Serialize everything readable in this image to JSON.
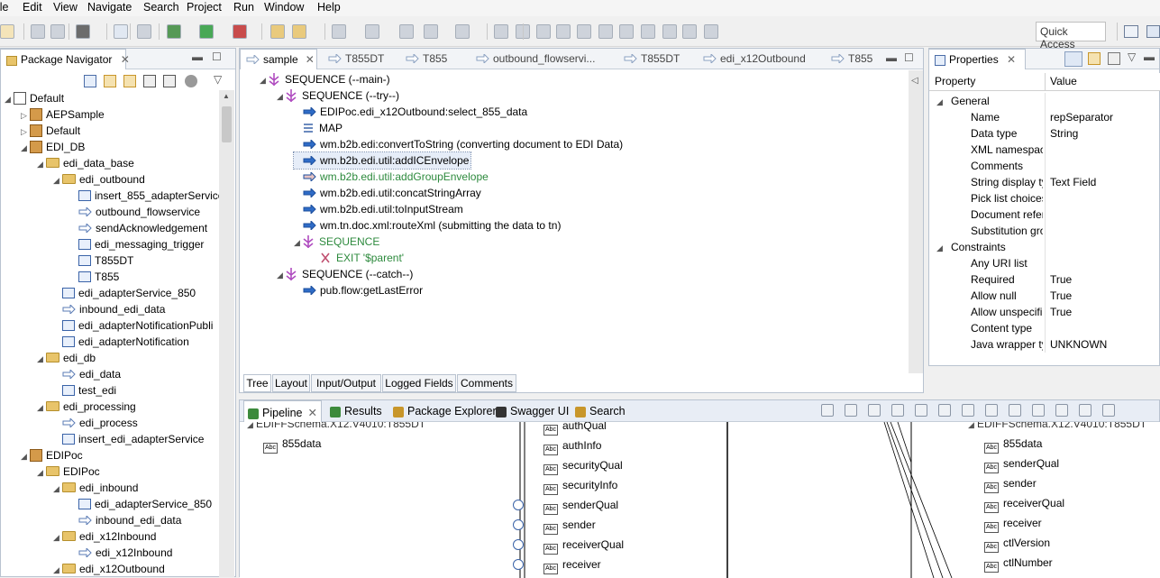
{
  "menu": [
    "ile",
    "Edit",
    "View",
    "Navigate",
    "Search",
    "Project",
    "Run",
    "Window",
    "Help"
  ],
  "toolbar": {
    "quick_access": "Quick Access"
  },
  "navigator": {
    "title": "Package Navigator",
    "items": [
      {
        "label": "Default",
        "depth": 0,
        "kind": "root",
        "exp": "open"
      },
      {
        "label": "AEPSample",
        "depth": 1,
        "kind": "pkg",
        "exp": "closed"
      },
      {
        "label": "Default",
        "depth": 1,
        "kind": "pkg",
        "exp": "closed"
      },
      {
        "label": "EDI_DB",
        "depth": 1,
        "kind": "pkg",
        "exp": "open"
      },
      {
        "label": "edi_data_base",
        "depth": 2,
        "kind": "folder",
        "exp": "open"
      },
      {
        "label": "edi_outbound",
        "depth": 3,
        "kind": "folder",
        "exp": "open"
      },
      {
        "label": "insert_855_adapterService",
        "depth": 4,
        "kind": "adapter",
        "exp": ""
      },
      {
        "label": "outbound_flowservice",
        "depth": 4,
        "kind": "flow",
        "exp": ""
      },
      {
        "label": "sendAcknowledgement",
        "depth": 4,
        "kind": "flow",
        "exp": ""
      },
      {
        "label": "edi_messaging_trigger",
        "depth": 4,
        "kind": "trigger",
        "exp": ""
      },
      {
        "label": "T855DT",
        "depth": 4,
        "kind": "doc",
        "exp": ""
      },
      {
        "label": "T855",
        "depth": 4,
        "kind": "schema",
        "exp": ""
      },
      {
        "label": "edi_adapterService_850",
        "depth": 3,
        "kind": "adapter",
        "exp": ""
      },
      {
        "label": "inbound_edi_data",
        "depth": 3,
        "kind": "flow",
        "exp": ""
      },
      {
        "label": "edi_adapterNotificationPubli",
        "depth": 3,
        "kind": "doc",
        "exp": ""
      },
      {
        "label": "edi_adapterNotification",
        "depth": 3,
        "kind": "adapter",
        "exp": ""
      },
      {
        "label": "edi_db",
        "depth": 2,
        "kind": "folder",
        "exp": "open"
      },
      {
        "label": "edi_data",
        "depth": 3,
        "kind": "flow",
        "exp": ""
      },
      {
        "label": "test_edi",
        "depth": 3,
        "kind": "java",
        "exp": ""
      },
      {
        "label": "edi_processing",
        "depth": 2,
        "kind": "folder",
        "exp": "open"
      },
      {
        "label": "edi_process",
        "depth": 3,
        "kind": "flow",
        "exp": ""
      },
      {
        "label": "insert_edi_adapterService",
        "depth": 3,
        "kind": "adapter",
        "exp": ""
      },
      {
        "label": "EDIPoc",
        "depth": 1,
        "kind": "pkg",
        "exp": "open"
      },
      {
        "label": "EDIPoc",
        "depth": 2,
        "kind": "folder",
        "exp": "open"
      },
      {
        "label": "edi_inbound",
        "depth": 3,
        "kind": "folder",
        "exp": "open"
      },
      {
        "label": "edi_adapterService_850",
        "depth": 4,
        "kind": "adapter",
        "exp": ""
      },
      {
        "label": "inbound_edi_data",
        "depth": 4,
        "kind": "flow",
        "exp": ""
      },
      {
        "label": "edi_x12Inbound",
        "depth": 3,
        "kind": "folder",
        "exp": "open"
      },
      {
        "label": "edi_x12Inbound",
        "depth": 4,
        "kind": "flow",
        "exp": ""
      },
      {
        "label": "edi_x12Outbound",
        "depth": 3,
        "kind": "folder",
        "exp": "open"
      }
    ]
  },
  "editor": {
    "tabs": [
      "sample",
      "T855DT",
      "T855",
      "outbound_flowservi...",
      "T855DT",
      "edi_x12Outbound",
      "T855"
    ],
    "steps": [
      {
        "label": "SEQUENCE (--main-)",
        "depth": 0,
        "kind": "seq",
        "exp": "open",
        "style": ""
      },
      {
        "label": "SEQUENCE (--try--)",
        "depth": 1,
        "kind": "seq",
        "exp": "open",
        "style": ""
      },
      {
        "label": "EDIPoc.edi_x12Outbound:select_855_data",
        "depth": 2,
        "kind": "invoke",
        "exp": "",
        "style": ""
      },
      {
        "label": "MAP",
        "depth": 2,
        "kind": "map",
        "exp": "",
        "style": ""
      },
      {
        "label": "wm.b2b.edi:convertToString (converting document to EDI Data)",
        "depth": 2,
        "kind": "invoke",
        "exp": "",
        "style": ""
      },
      {
        "label": "wm.b2b.edi.util:addICEnvelope",
        "depth": 2,
        "kind": "invoke",
        "exp": "",
        "style": "selected"
      },
      {
        "label": "wm.b2b.edi.util:addGroupEnvelope",
        "depth": 2,
        "kind": "disabled",
        "exp": "",
        "style": "green"
      },
      {
        "label": "wm.b2b.edi.util:concatStringArray",
        "depth": 2,
        "kind": "invoke",
        "exp": "",
        "style": ""
      },
      {
        "label": "wm.b2b.edi.util:toInputStream",
        "depth": 2,
        "kind": "invoke",
        "exp": "",
        "style": ""
      },
      {
        "label": "wm.tn.doc.xml:routeXml (submitting the data to tn)",
        "depth": 2,
        "kind": "invoke",
        "exp": "",
        "style": ""
      },
      {
        "label": "SEQUENCE",
        "depth": 2,
        "kind": "seqdisabled",
        "exp": "open",
        "style": "green"
      },
      {
        "label": "EXIT '$parent'",
        "depth": 3,
        "kind": "exit",
        "exp": "",
        "style": "green"
      },
      {
        "label": "SEQUENCE (--catch--)",
        "depth": 1,
        "kind": "seq",
        "exp": "open",
        "style": ""
      },
      {
        "label": "pub.flow:getLastError",
        "depth": 2,
        "kind": "invoke",
        "exp": "",
        "style": ""
      }
    ],
    "bottom_tabs": [
      "Tree",
      "Layout",
      "Input/Output",
      "Logged Fields",
      "Comments"
    ]
  },
  "properties": {
    "title": "Properties",
    "col_property": "Property",
    "col_value": "Value",
    "rows": [
      {
        "name": "General",
        "value": "",
        "group": true
      },
      {
        "name": "Name",
        "value": "repSeparator",
        "group": false
      },
      {
        "name": "Data type",
        "value": "String",
        "group": false
      },
      {
        "name": "XML namespac",
        "value": "",
        "group": false
      },
      {
        "name": "Comments",
        "value": "",
        "group": false
      },
      {
        "name": "String display ty",
        "value": "Text Field",
        "group": false
      },
      {
        "name": "Pick list choices",
        "value": "",
        "group": false
      },
      {
        "name": "Document refer",
        "value": "",
        "group": false
      },
      {
        "name": "Substitution gro",
        "value": "",
        "group": false
      },
      {
        "name": "Constraints",
        "value": "",
        "group": true
      },
      {
        "name": "Any URI list",
        "value": "",
        "group": false
      },
      {
        "name": "Required",
        "value": "True",
        "group": false
      },
      {
        "name": "Allow null",
        "value": "True",
        "group": false
      },
      {
        "name": "Allow unspecifi",
        "value": "True",
        "group": false
      },
      {
        "name": "Content type",
        "value": "",
        "group": false
      },
      {
        "name": "Java wrapper ty",
        "value": "UNKNOWN",
        "group": false
      }
    ]
  },
  "bottom": {
    "tabs": [
      "Pipeline",
      "Results",
      "Package Explorer",
      "Swagger UI",
      "Search"
    ],
    "left_doc": "EDIFFSchema.X12.V4010:T855DT",
    "left_fields": [
      "855data"
    ],
    "middle_fields": [
      "authQual",
      "authInfo",
      "securityQual",
      "securityInfo",
      "senderQual",
      "sender",
      "receiverQual",
      "receiver"
    ],
    "right_doc": "EDIFFSchema.X12.V4010:T855DT",
    "right_fields": [
      "855data",
      "senderQual",
      "sender",
      "receiverQual",
      "receiver",
      "ctlVersion",
      "ctlNumber"
    ]
  }
}
